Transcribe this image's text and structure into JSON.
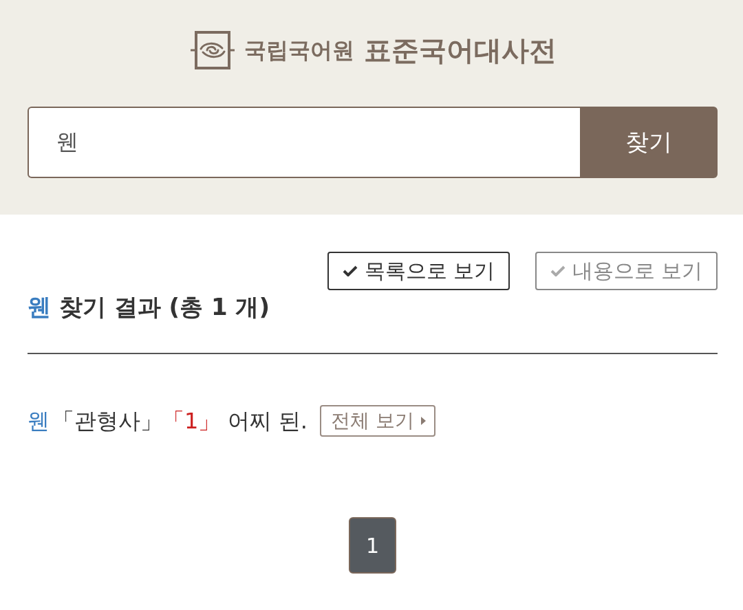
{
  "header": {
    "logo": {
      "org": "국립국어원",
      "title": "표준국어대사전"
    }
  },
  "search": {
    "value": "웬",
    "button": "찾기"
  },
  "view_toggles": [
    {
      "label": "목록으로 보기",
      "selected": true
    },
    {
      "label": "내용으로 보기",
      "selected": false
    }
  ],
  "results_heading": {
    "query": "웬",
    "text": "찾기 결과 (총 1 개)"
  },
  "results": [
    {
      "word": "웬",
      "pos": "「관형사」",
      "sense": "「1」",
      "definition": "어찌 된.",
      "more": "전체 보기"
    }
  ],
  "pagination": [
    {
      "label": "1",
      "selected": true
    }
  ]
}
